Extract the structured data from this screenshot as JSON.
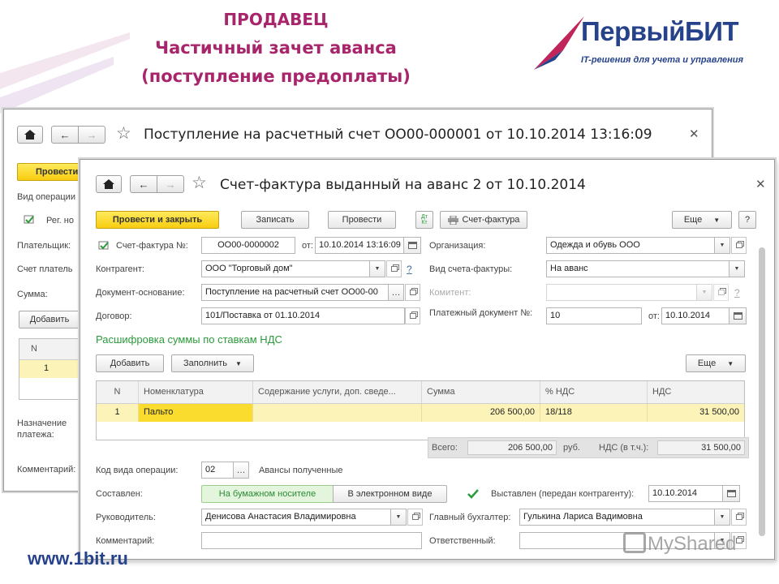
{
  "slide": {
    "title_line1": "ПРОДАВЕЦ",
    "title_line2": "Частичный зачет аванса",
    "title_line3": "(поступление предоплаты)",
    "logo_name": "ПервыйБИТ",
    "logo_tagline": "IT-решения для учета и управления",
    "footer_url": "www.1bit.ru",
    "watermark": "MyShared"
  },
  "back_window": {
    "title": "Поступление на расчетный счет ОО00-000001 от 10.10.2014 13:16:09",
    "post_button": "Провести",
    "labels": {
      "operation_type": "Вид операции",
      "reg": "Рег. но",
      "payer": "Плательщик:",
      "payer_account": "Счет платель",
      "amount": "Сумма:",
      "purpose": "Назначение платежа:",
      "comment": "Комментарий:"
    },
    "add_button": "Добавить",
    "table_header_n": "N",
    "row_n": "1"
  },
  "front_window": {
    "title": "Счет-фактура выданный на аванс 2 от 10.10.2014",
    "toolbar": {
      "post_and_close": "Провести и закрыть",
      "save": "Записать",
      "post": "Провести",
      "dtkt_icon_text": "Дт Кт",
      "invoice": "Счет-фактура",
      "more": "Еще",
      "help": "?"
    },
    "form": {
      "invoice_no_label": "Счет-фактура №:",
      "invoice_no": "ОО00-0000002",
      "from_label": "от:",
      "invoice_date": "10.10.2014 13:16:09",
      "org_label": "Организация:",
      "org": "Одежда и обувь ООО",
      "counterparty_label": "Контрагент:",
      "counterparty": "ООО \"Торговый дом\"",
      "counterparty_help": "?",
      "invoice_type_label": "Вид счета-фактуры:",
      "invoice_type": "На аванс",
      "base_doc_label": "Документ-основание:",
      "base_doc": "Поступление на расчетный счет ОО00-00",
      "committent_label": "Комитент:",
      "committent": "",
      "contract_label": "Договор:",
      "contract": "101/Поставка от 01.10.2014",
      "payment_doc_label": "Платежный документ №:",
      "payment_doc_no": "10",
      "payment_doc_from_label": "от:",
      "payment_doc_date": "10.10.2014"
    },
    "vat_section": {
      "title": "Расшифровка суммы по ставкам НДС",
      "add": "Добавить",
      "fill": "Заполнить",
      "more": "Еще",
      "columns": [
        "N",
        "Номенклатура",
        "Содержание услуги, доп. сведе...",
        "Сумма",
        "% НДС",
        "НДС"
      ],
      "rows": [
        {
          "n": "1",
          "item": "Пальто",
          "content": "",
          "amount": "206 500,00",
          "vat_rate": "18/118",
          "vat": "31 500,00"
        }
      ],
      "totals": {
        "total_label": "Всего:",
        "total": "206 500,00",
        "currency": "руб.",
        "vat_label": "НДС (в т.ч.):",
        "vat_total": "31 500,00"
      }
    },
    "footer": {
      "op_code_label": "Код вида операции:",
      "op_code": "02",
      "op_code_desc": "Авансы полученные",
      "issued_label": "Составлен:",
      "paper": "На бумажном носителе",
      "electronic": "В электронном виде",
      "sent_label": "Выставлен (передан контрагенту):",
      "sent_date": "10.10.2014",
      "head_label": "Руководитель:",
      "head": "Денисова Анастасия Владимировна",
      "accountant_label": "Главный бухгалтер:",
      "accountant": "Гулькина Лариса Вадимовна",
      "comment_label": "Комментарий:",
      "comment": "",
      "responsible_label": "Ответственный:",
      "responsible": ""
    }
  },
  "colors": {
    "title_magenta": "#a8246b",
    "brand_blue": "#26428b",
    "post_yellow": "#f7cd10",
    "row_yellow": "#fcf3b8",
    "section_green": "#2b9a3a"
  }
}
